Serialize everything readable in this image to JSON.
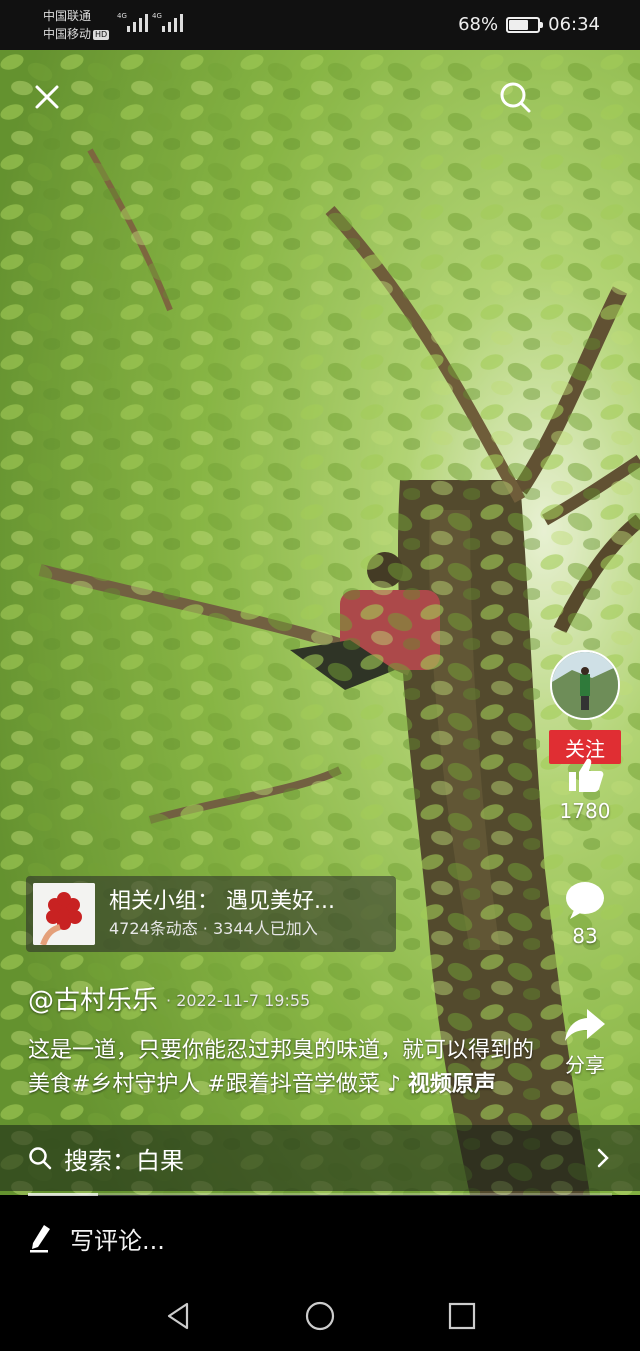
{
  "status_bar": {
    "carrier_1": "中国联通",
    "carrier_2": "中国移动",
    "hd_badge": "HD",
    "network_1": "4G",
    "network_2": "4G",
    "battery_percent": "68%",
    "battery_level": 0.68,
    "time": "06:34"
  },
  "top_bar": {
    "close_icon": "close-icon",
    "search_icon": "search-icon"
  },
  "right_rail": {
    "follow_label": "关注",
    "like_count": "1780",
    "comment_count": "83",
    "share_label": "分享"
  },
  "group_card": {
    "title": "相关小组：  遇见美好...",
    "stats": "4724条动态 · 3344人已加入"
  },
  "post": {
    "author": "@古村乐乐",
    "date": "· 2022-11-7 19:55",
    "caption": "这是一道，只要你能忍过邦臭的味道，就可以得到的美食#乡村守护人 #跟着抖音学做菜",
    "music_note": "♪",
    "music": "视频原声"
  },
  "search_bar": {
    "label": "搜索：白果",
    "chevron": "chevron-right-icon"
  },
  "playback": {
    "progress": 0.12
  },
  "comment_bar": {
    "placeholder": "写评论..."
  },
  "nav_bar": {
    "back": "back-icon",
    "home": "home-icon",
    "recents": "recents-icon"
  },
  "colors": {
    "follow_red": "#e02e33",
    "status_bg": "#111111",
    "foliage": "#8fbf4a"
  }
}
